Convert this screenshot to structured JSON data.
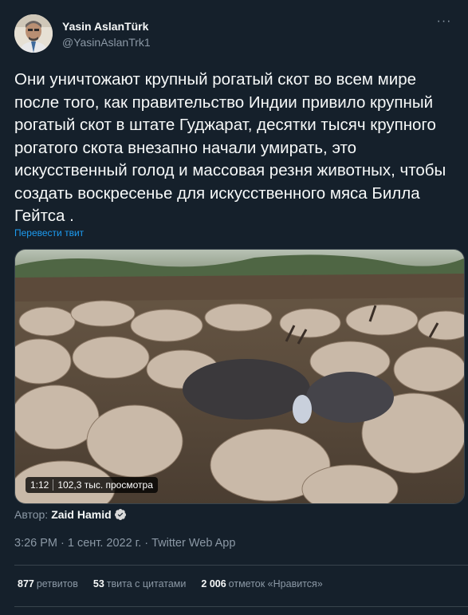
{
  "author": {
    "display_name": "Yasin AslanTürk",
    "handle": "@YasinAslanTrk1"
  },
  "tweet": {
    "text": "Они уничтожают крупный рогатый скот во всем мире после того, как правительство Индии привило крупный рогатый скот в штате Гуджарат, десятки тысяч крупного рогатого скота внезапно начали умирать, это искусственный голод и массовая резня животных, чтобы создать воскресенье для искусственного мяса Билла Гейтса .",
    "translate_label": "Перевести твит"
  },
  "video": {
    "duration": "1:12",
    "views": "102,3 тыс. просмотра"
  },
  "attribution": {
    "label": "Автор:",
    "name": "Zaid Hamid"
  },
  "meta": {
    "timestamp": "3:26 PM · 1 сент. 2022 г. · Twitter Web App"
  },
  "stats": {
    "retweets_count": "877",
    "retweets_label": "ретвитов",
    "quotes_count": "53",
    "quotes_label": "твита с цитатами",
    "likes_count": "2 006",
    "likes_label": "отметок «Нравится»"
  },
  "colors": {
    "background": "#15202b",
    "accent": "#1d9bf0",
    "secondary_text": "#8b98a5"
  },
  "icons": [
    "more-icon",
    "verified-badge-icon"
  ]
}
